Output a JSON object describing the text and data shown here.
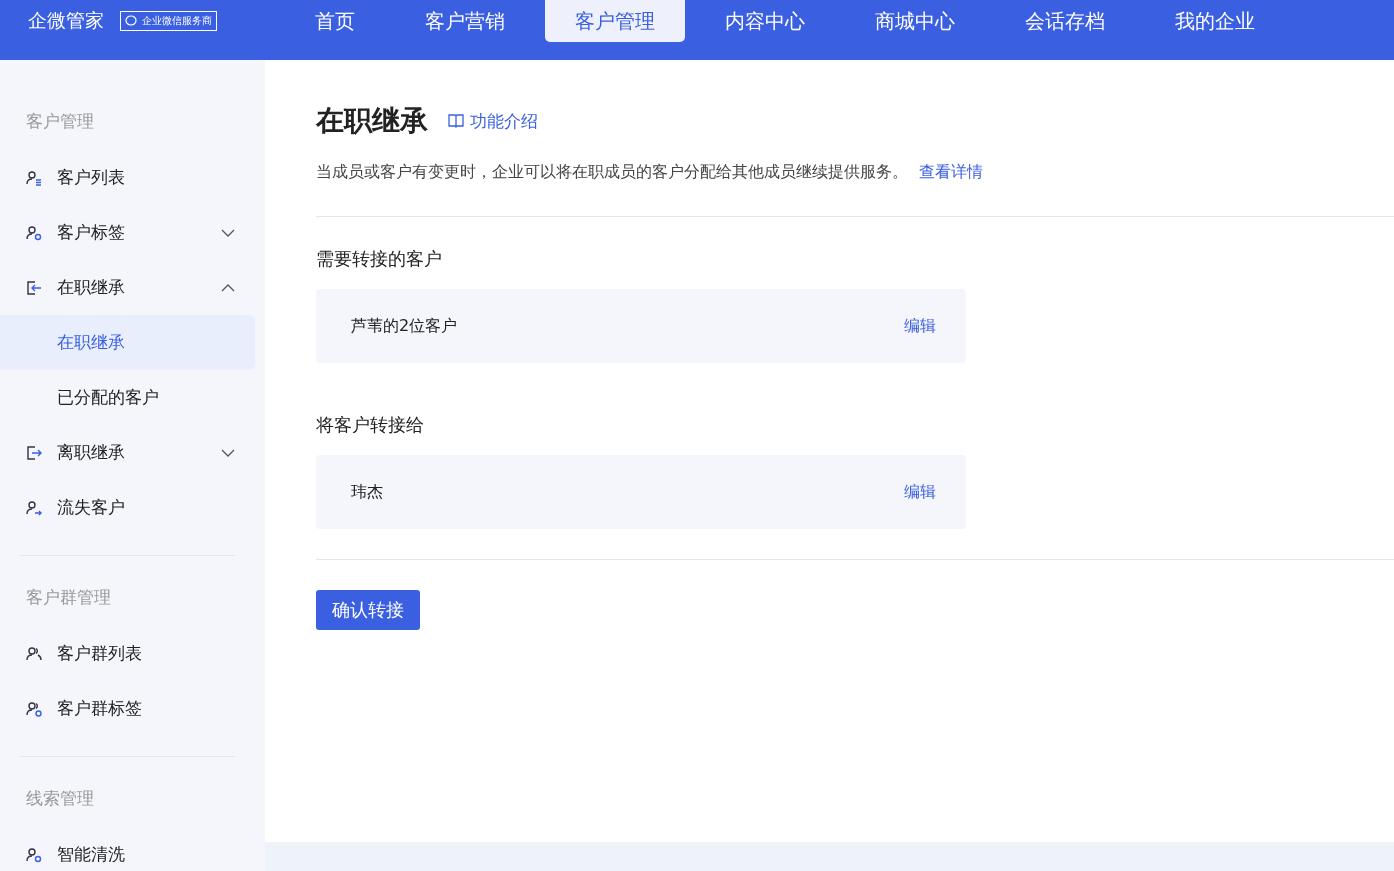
{
  "header": {
    "logo": "企微管家",
    "badge": "企业微信服务商",
    "nav": [
      {
        "label": "首页",
        "selected": false
      },
      {
        "label": "客户营销",
        "selected": false
      },
      {
        "label": "客户管理",
        "selected": true
      },
      {
        "label": "内容中心",
        "selected": false
      },
      {
        "label": "商城中心",
        "selected": false
      },
      {
        "label": "会话存档",
        "selected": false
      },
      {
        "label": "我的企业",
        "selected": false
      }
    ]
  },
  "sidebar": {
    "sections": [
      {
        "title": "客户管理",
        "items": [
          {
            "label": "客户列表",
            "selected": false
          },
          {
            "label": "客户标签",
            "expanded": false,
            "selected": false
          },
          {
            "label": "在职继承",
            "expanded": true,
            "selected": false,
            "children": [
              {
                "label": "在职继承",
                "selected": true
              },
              {
                "label": "已分配的客户",
                "selected": false
              }
            ]
          },
          {
            "label": "离职继承",
            "expanded": false,
            "selected": false
          },
          {
            "label": "流失客户",
            "selected": false
          }
        ]
      },
      {
        "title": "客户群管理",
        "items": [
          {
            "label": "客户群列表",
            "selected": false
          },
          {
            "label": "客户群标签",
            "selected": false
          }
        ]
      },
      {
        "title": "线索管理",
        "items": [
          {
            "label": "智能清洗",
            "selected": false
          }
        ]
      }
    ]
  },
  "page": {
    "title": "在职继承",
    "intro_link": "功能介绍",
    "description": "当成员或客户有变更时，企业可以将在职成员的客户分配给其他成员继续提供服务。",
    "details_link": "查看详情",
    "fields": [
      {
        "label": "需要转接的客户",
        "value": "芦苇的2位客户",
        "action": "编辑"
      },
      {
        "label": "将客户转接给",
        "value": "玮杰",
        "action": "编辑"
      }
    ],
    "confirm_button": "确认转接"
  }
}
